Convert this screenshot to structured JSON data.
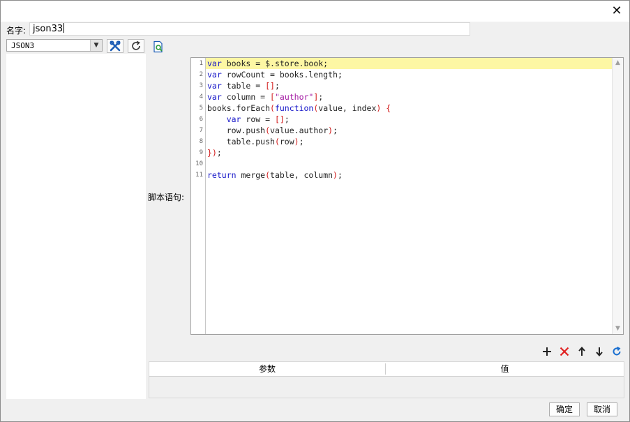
{
  "dialog": {
    "close_glyph": "✕"
  },
  "name_field": {
    "label": "名字:",
    "value": "json33"
  },
  "datasource": {
    "selected": "JSON3"
  },
  "toolbar": {
    "icons": [
      "tools-icon",
      "refresh-icon",
      "preview-icon"
    ]
  },
  "script": {
    "label": "脚本语句:",
    "line_numbers": [
      "1",
      "2",
      "3",
      "4",
      "5",
      "6",
      "7",
      "8",
      "9",
      "10",
      "11"
    ],
    "lines": [
      "var books = $.store.book;",
      "var rowCount = books.length;",
      "var table = [];",
      "var column = [\"author\"];",
      "books.forEach(function(value, index) {",
      "    var row = [];",
      "    row.push(value.author);",
      "    table.push(row);",
      "});",
      "",
      "return merge(table, column);"
    ]
  },
  "params": {
    "tools": [
      "add-icon",
      "delete-icon",
      "move-up-icon",
      "move-down-icon",
      "refresh-icon"
    ],
    "columns": [
      "参数",
      "值"
    ]
  },
  "buttons": {
    "ok": "确定",
    "cancel": "取消"
  },
  "colors": {
    "keyword": "#1515c8",
    "string": "#a31aa3",
    "punct": "#d21a1a",
    "active_line": "#fdf7a4",
    "tool_blue": "#1a5bb5",
    "delete_red": "#e02020"
  }
}
